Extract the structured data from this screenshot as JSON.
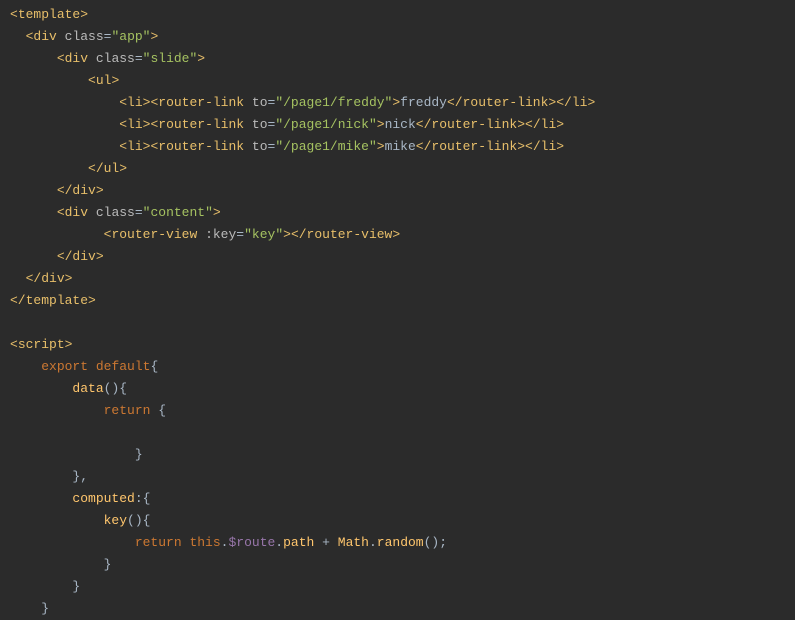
{
  "lines": [
    {
      "type": "tag-open",
      "indent": 0,
      "tag": "template"
    },
    {
      "type": "tag-open-attrs",
      "indent": 1,
      "tag": "div",
      "attrs": [
        {
          "name": "class",
          "value": "app"
        }
      ]
    },
    {
      "type": "tag-open-attrs",
      "indent": 3,
      "tag": "div",
      "attrs": [
        {
          "name": "class",
          "value": "slide"
        }
      ]
    },
    {
      "type": "tag-open",
      "indent": 5,
      "tag": "ul"
    },
    {
      "type": "li-router",
      "indent": 7,
      "to": "/page1/freddy",
      "text": "freddy"
    },
    {
      "type": "li-router",
      "indent": 7,
      "to": "/page1/nick",
      "text": "nick"
    },
    {
      "type": "li-router",
      "indent": 7,
      "to": "/page1/mike",
      "text": "mike"
    },
    {
      "type": "tag-close",
      "indent": 5,
      "tag": "ul"
    },
    {
      "type": "tag-close",
      "indent": 3,
      "tag": "div"
    },
    {
      "type": "tag-open-attrs",
      "indent": 3,
      "tag": "div",
      "attrs": [
        {
          "name": "class",
          "value": "content"
        }
      ]
    },
    {
      "type": "router-view",
      "indent": 6,
      "attrs": [
        {
          "name": ":key",
          "value": "key"
        }
      ]
    },
    {
      "type": "tag-close",
      "indent": 3,
      "tag": "div"
    },
    {
      "type": "tag-close",
      "indent": 1,
      "tag": "div"
    },
    {
      "type": "tag-close",
      "indent": 0,
      "tag": "template"
    },
    {
      "type": "blank"
    },
    {
      "type": "tag-open",
      "indent": 0,
      "tag": "script"
    },
    {
      "type": "js",
      "indent": 2,
      "tokens": [
        {
          "t": "keyword",
          "v": "export"
        },
        {
          "t": "sp",
          "v": " "
        },
        {
          "t": "kw-default",
          "v": "default"
        },
        {
          "t": "punct",
          "v": "{"
        }
      ]
    },
    {
      "type": "js",
      "indent": 4,
      "tokens": [
        {
          "t": "func-name",
          "v": "data"
        },
        {
          "t": "paren",
          "v": "(){"
        }
      ]
    },
    {
      "type": "js",
      "indent": 6,
      "tokens": [
        {
          "t": "kw-return",
          "v": "return"
        },
        {
          "t": "sp",
          "v": " "
        },
        {
          "t": "punct",
          "v": "{"
        }
      ]
    },
    {
      "type": "blank"
    },
    {
      "type": "js",
      "indent": 8,
      "tokens": [
        {
          "t": "punct",
          "v": "}"
        }
      ]
    },
    {
      "type": "js",
      "indent": 4,
      "tokens": [
        {
          "t": "punct",
          "v": "},"
        }
      ]
    },
    {
      "type": "js",
      "indent": 4,
      "tokens": [
        {
          "t": "identifier",
          "v": "computed"
        },
        {
          "t": "punct",
          "v": ":{"
        }
      ]
    },
    {
      "type": "js",
      "indent": 6,
      "tokens": [
        {
          "t": "func-name",
          "v": "key"
        },
        {
          "t": "paren",
          "v": "(){"
        }
      ]
    },
    {
      "type": "js",
      "indent": 8,
      "tokens": [
        {
          "t": "kw-return",
          "v": "return"
        },
        {
          "t": "sp",
          "v": " "
        },
        {
          "t": "kw-this",
          "v": "this"
        },
        {
          "t": "punct",
          "v": "."
        },
        {
          "t": "property",
          "v": "$route"
        },
        {
          "t": "punct",
          "v": "."
        },
        {
          "t": "identifier",
          "v": "path"
        },
        {
          "t": "sp",
          "v": " "
        },
        {
          "t": "operator",
          "v": "+"
        },
        {
          "t": "sp",
          "v": " "
        },
        {
          "t": "builtin",
          "v": "Math"
        },
        {
          "t": "punct",
          "v": "."
        },
        {
          "t": "func-name",
          "v": "random"
        },
        {
          "t": "paren",
          "v": "();"
        }
      ]
    },
    {
      "type": "js",
      "indent": 6,
      "tokens": [
        {
          "t": "punct",
          "v": "}"
        }
      ]
    },
    {
      "type": "js",
      "indent": 4,
      "tokens": [
        {
          "t": "punct",
          "v": "}"
        }
      ]
    },
    {
      "type": "js",
      "indent": 2,
      "tokens": [
        {
          "t": "punct",
          "v": "}"
        }
      ]
    }
  ]
}
